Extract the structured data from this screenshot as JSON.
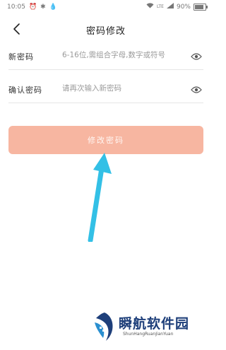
{
  "status_bar": {
    "time": "10:05",
    "network_type": "LTE",
    "battery": "90%"
  },
  "header": {
    "title": "密码修改"
  },
  "form": {
    "new_password": {
      "label": "新密码",
      "placeholder": "6-16位,需组合字母,数字或符号",
      "value": ""
    },
    "confirm_password": {
      "label": "确认密码",
      "placeholder": "请再次输入新密码",
      "value": ""
    }
  },
  "actions": {
    "submit_label": "修改密码"
  },
  "annotation": {
    "arrow_color": "#33c0e6"
  },
  "watermark": {
    "title": "瞬航软件园",
    "subtitle": "ShunHangRuanJianYuan"
  },
  "colors": {
    "button_bg": "#f7b6a1",
    "divider": "#e6e6e6",
    "watermark": "#1e3f7a"
  }
}
